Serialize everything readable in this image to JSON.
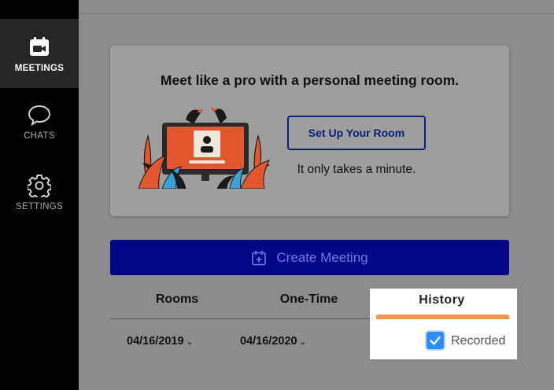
{
  "sidebar": {
    "items": [
      {
        "label": "MEETINGS",
        "icon": "meetings-icon",
        "active": true
      },
      {
        "label": "CHATS",
        "icon": "chat-icon",
        "active": false
      },
      {
        "label": "SETTINGS",
        "icon": "gear-icon",
        "active": false
      }
    ]
  },
  "promo": {
    "title": "Meet like a pro with a personal meeting room.",
    "button_label": "Set Up Your Room",
    "subtitle": "It only takes a minute."
  },
  "create": {
    "label": "Create Meeting",
    "icon": "calendar-plus-icon"
  },
  "tabs": [
    {
      "label": "Rooms"
    },
    {
      "label": "One-Time"
    },
    {
      "label": "History"
    }
  ],
  "filters": {
    "rooms_date": "04/16/2019",
    "onetime_date": "04/16/2020",
    "recorded_label": "Recorded",
    "recorded_checked": true
  },
  "colors": {
    "accent": "#04068a",
    "history_bar": "#f0954a",
    "checkbox": "#2d8cff"
  }
}
